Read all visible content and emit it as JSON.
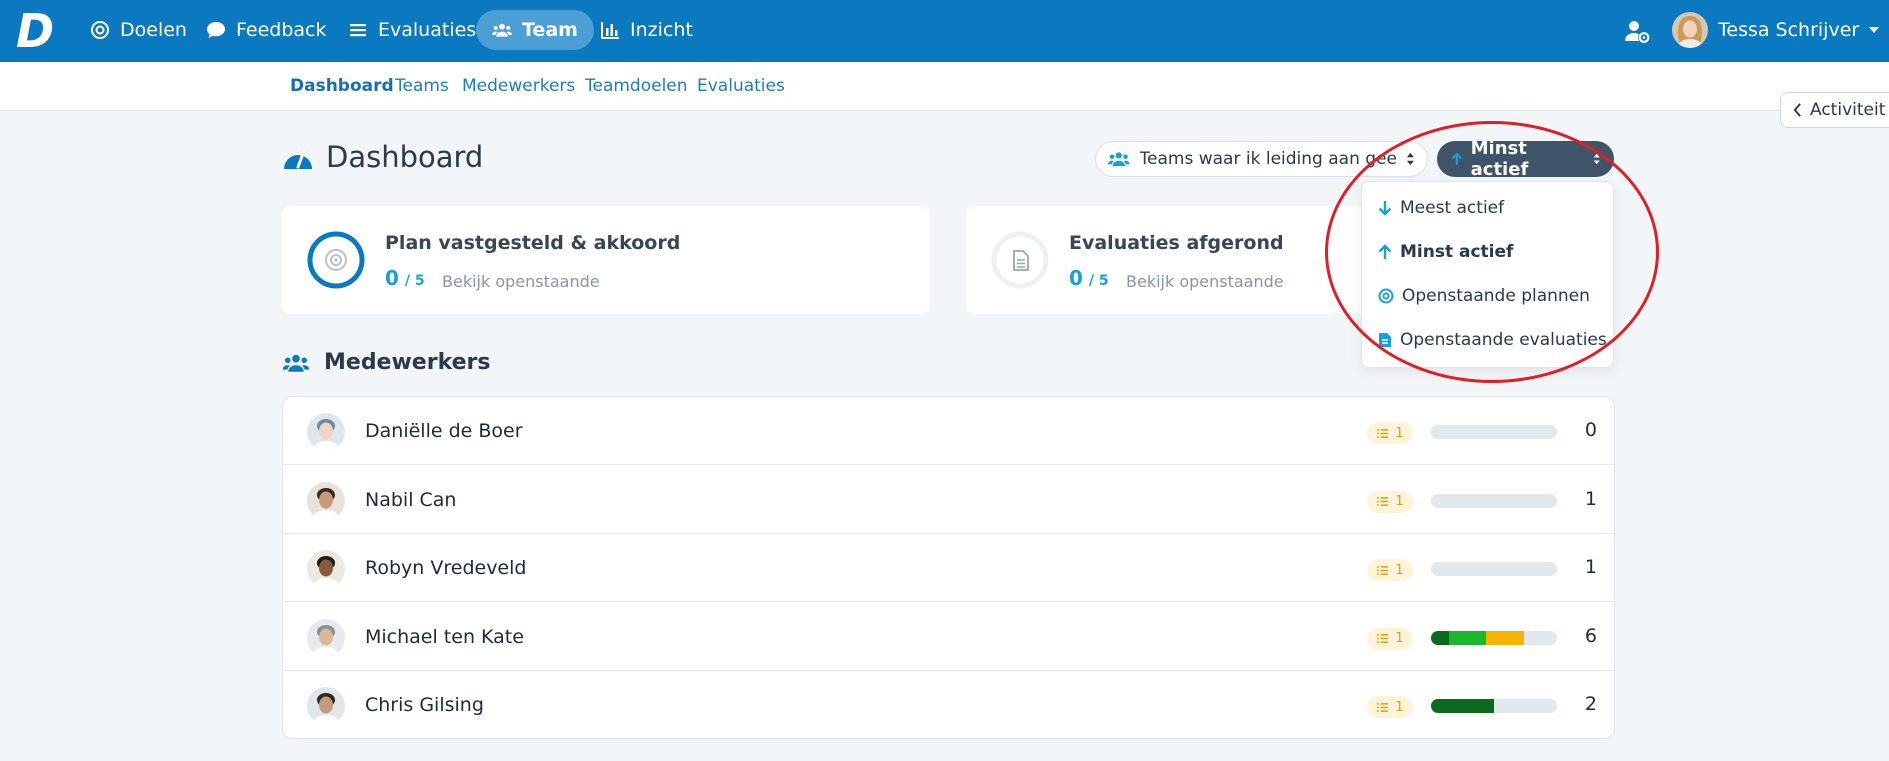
{
  "topbar": {
    "logo": "D",
    "nav": [
      {
        "label": "Doelen",
        "icon": "target-icon"
      },
      {
        "label": "Feedback",
        "icon": "chat-icon"
      },
      {
        "label": "Evaluaties",
        "icon": "list-icon"
      },
      {
        "label": "Team",
        "icon": "users-icon",
        "active": true
      },
      {
        "label": "Inzicht",
        "icon": "chart-icon"
      }
    ],
    "user_name": "Tessa Schrijver"
  },
  "subnav": [
    "Dashboard",
    "Teams",
    "Medewerkers",
    "Teamdoelen",
    "Evaluaties"
  ],
  "activity_tab": "Activiteit",
  "page": {
    "title": "Dashboard",
    "team_filter": "Teams waar ik leiding aan geef",
    "sort_selected": "Minst actief"
  },
  "cards": [
    {
      "title": "Plan vastgesteld & akkoord",
      "count": "0",
      "total": "/ 5",
      "link": "Bekijk openstaande",
      "progress": 0
    },
    {
      "title": "Evaluaties afgerond",
      "count": "0",
      "total": "/ 5",
      "link": "Bekijk openstaande"
    }
  ],
  "employees_section": "Medewerkers",
  "employees": [
    {
      "name": "Daniëlle de Boer",
      "badge": "1",
      "score": "0",
      "segments": []
    },
    {
      "name": "Nabil Can",
      "badge": "1",
      "score": "1",
      "segments": []
    },
    {
      "name": "Robyn Vredeveld",
      "badge": "1",
      "score": "1",
      "segments": []
    },
    {
      "name": "Michael ten Kate",
      "badge": "1",
      "score": "6",
      "segments": [
        {
          "value": 0.14,
          "color": "#0a6b1f"
        },
        {
          "value": 0.3,
          "color": "#19b82f"
        },
        {
          "value": 0.3,
          "color": "#f5b400"
        }
      ]
    },
    {
      "name": "Chris Gilsing",
      "badge": "1",
      "score": "2",
      "segments": [
        {
          "value": 0.5,
          "color": "#0a6b1f"
        }
      ]
    }
  ],
  "dropdown": [
    {
      "label": "Meest actief",
      "icon": "arrow-down-icon"
    },
    {
      "label": "Minst actief",
      "icon": "arrow-up-icon",
      "selected": true
    },
    {
      "label": "Openstaande plannen",
      "icon": "target-icon"
    },
    {
      "label": "Openstaande evaluaties",
      "icon": "document-icon"
    }
  ],
  "colors": {
    "primary": "#0a79bf",
    "accent": "#1aa0d8",
    "annotation": "#e01e26"
  }
}
